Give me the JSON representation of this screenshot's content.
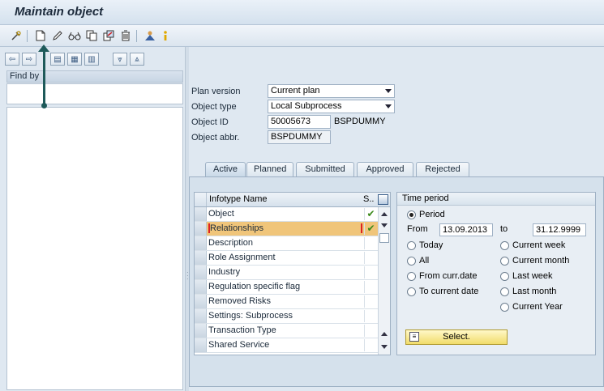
{
  "window": {
    "title": "Maintain object"
  },
  "toolbar": {
    "icons": [
      "gear-icon",
      "create-icon",
      "pencil-icon",
      "glasses-icon",
      "copy-icon",
      "delimit-icon",
      "delete-icon",
      "person-icon",
      "info-icon"
    ]
  },
  "left": {
    "find_by_label": "Find by"
  },
  "form": {
    "plan_version": {
      "label": "Plan version",
      "value": "Current plan"
    },
    "object_type": {
      "label": "Object type",
      "value": "Local Subprocess"
    },
    "object_id": {
      "label": "Object ID",
      "value": "50005673",
      "suffix": "BSPDUMMY"
    },
    "object_abbr": {
      "label": "Object abbr.",
      "value": "BSPDUMMY"
    }
  },
  "tabs": [
    {
      "label": "Active",
      "active": true
    },
    {
      "label": "Planned"
    },
    {
      "label": "Submitted"
    },
    {
      "label": "Approved"
    },
    {
      "label": "Rejected"
    }
  ],
  "infotype_table": {
    "col_name": "Infotype Name",
    "col_status": "S..",
    "rows": [
      {
        "name": "Object",
        "status": "✔"
      },
      {
        "name": "Relationships",
        "status": "✔",
        "selected": true
      },
      {
        "name": "Description",
        "status": ""
      },
      {
        "name": "Role Assignment",
        "status": ""
      },
      {
        "name": "Industry",
        "status": ""
      },
      {
        "name": "Regulation specific flag",
        "status": ""
      },
      {
        "name": "Removed Risks",
        "status": ""
      },
      {
        "name": "Settings: Subprocess",
        "status": ""
      },
      {
        "name": "Transaction Type",
        "status": ""
      },
      {
        "name": "Shared Service",
        "status": ""
      }
    ]
  },
  "time_period": {
    "title": "Time period",
    "period_label": "Period",
    "from_label": "From",
    "from_value": "13.09.2013",
    "to_label": "to",
    "to_value": "31.12.9999",
    "options_left": [
      "Today",
      "All",
      "From curr.date",
      "To current date"
    ],
    "options_right": [
      "Current week",
      "Current month",
      "Last week",
      "Last month",
      "Current Year"
    ],
    "select_button": "Select."
  },
  "colors": {
    "selected_row": "#f0c57a",
    "select_button": "#f1dc6a",
    "annotation_arrow": "#1e5a5a"
  }
}
